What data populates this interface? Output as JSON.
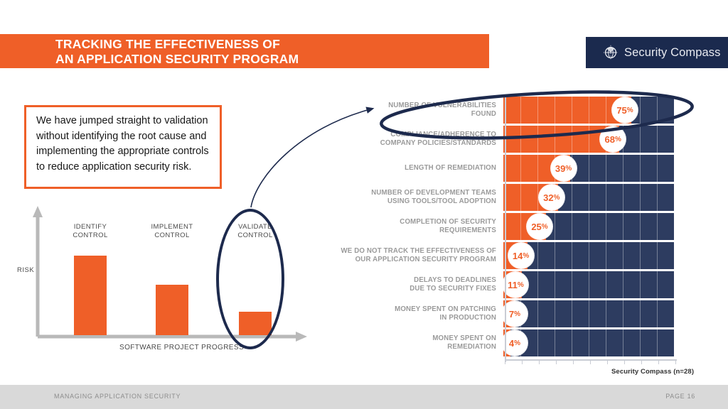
{
  "slide": {
    "title_line1": "TRACKING THE EFFECTIVENESS OF",
    "title_line2": "AN APPLICATION SECURITY PROGRAM",
    "accent_orange": "#ef5f28",
    "accent_navy": "#1b2a4e",
    "track_navy": "#2d3c60"
  },
  "logo": {
    "text": "Security Compass",
    "icon": "globe-compass-icon"
  },
  "callout": {
    "text": "We have jumped straight to validation without identifying the root cause and implementing the appropriate controls to reduce application security risk."
  },
  "risk_chart": {
    "ylabel": "RISK",
    "xlabel": "SOFTWARE PROJECT PROGRESS",
    "bars": [
      {
        "label_line1": "IDENTIFY",
        "label_line2": "CONTROL",
        "height_pct": 100,
        "highlighted": false
      },
      {
        "label_line1": "IMPLEMENT",
        "label_line2": "CONTROL",
        "height_pct": 62,
        "highlighted": false
      },
      {
        "label_line1": "VALIDATE",
        "label_line2": "CONTROL",
        "height_pct": 28,
        "highlighted": true
      }
    ]
  },
  "chart_data": {
    "type": "bar",
    "orientation": "horizontal",
    "title": "",
    "xlabel": "",
    "ylabel": "",
    "xlim": [
      0,
      100
    ],
    "grid": true,
    "legend": false,
    "source_note": "Security Compass (n=28)",
    "value_suffix": "%",
    "categories": [
      "NUMBER OF VULNERABILITIES FOUND",
      "COMPLIANCE/ADHERENCE TO COMPANY POLICIES/STANDARDS",
      "LENGTH OF REMEDIATION",
      "NUMBER OF DEVELOPMENT TEAMS USING TOOLS/TOOL ADOPTION",
      "COMPLETION OF SECURITY REQUIREMENTS",
      "WE DO NOT TRACK THE EFFECTIVENESS OF OUR APPLICATION SECURITY PROGRAM",
      "DELAYS TO DEADLINES DUE TO SECURITY FIXES",
      "MONEY SPENT ON PATCHING IN PRODUCTION",
      "MONEY SPENT ON REMEDIATION"
    ],
    "category_lines": [
      [
        "NUMBER OF VULNERABILITIES",
        "FOUND"
      ],
      [
        "COMPLIANCE/ADHERENCE TO",
        "COMPANY POLICIES/STANDARDS"
      ],
      [
        "LENGTH OF REMEDIATION"
      ],
      [
        "NUMBER OF DEVELOPMENT TEAMS",
        "USING TOOLS/TOOL ADOPTION"
      ],
      [
        "COMPLETION OF SECURITY",
        "REQUIREMENTS"
      ],
      [
        "WE DO NOT TRACK THE EFFECTIVENESS OF",
        "OUR APPLICATION SECURITY PROGRAM"
      ],
      [
        "DELAYS TO DEADLINES",
        "DUE TO SECURITY FIXES"
      ],
      [
        "MONEY SPENT ON PATCHING",
        "IN PRODUCTION"
      ],
      [
        "MONEY SPENT ON",
        "REMEDIATION"
      ]
    ],
    "values": [
      75,
      68,
      39,
      32,
      25,
      14,
      11,
      7,
      4
    ],
    "value_labels": [
      "75%",
      "68%",
      "39%",
      "32%",
      "25%",
      "14%",
      "11%",
      "7%",
      "4%"
    ]
  },
  "annotations": {
    "highlight_ellipse_top_bar": "ellipse-around-number-of-vulnerabilities-found",
    "arrow": "curved-arrow-from-validate-control-to-top-bar"
  },
  "footer": {
    "left": "MANAGING APPLICATION SECURITY",
    "right": "PAGE 16"
  }
}
